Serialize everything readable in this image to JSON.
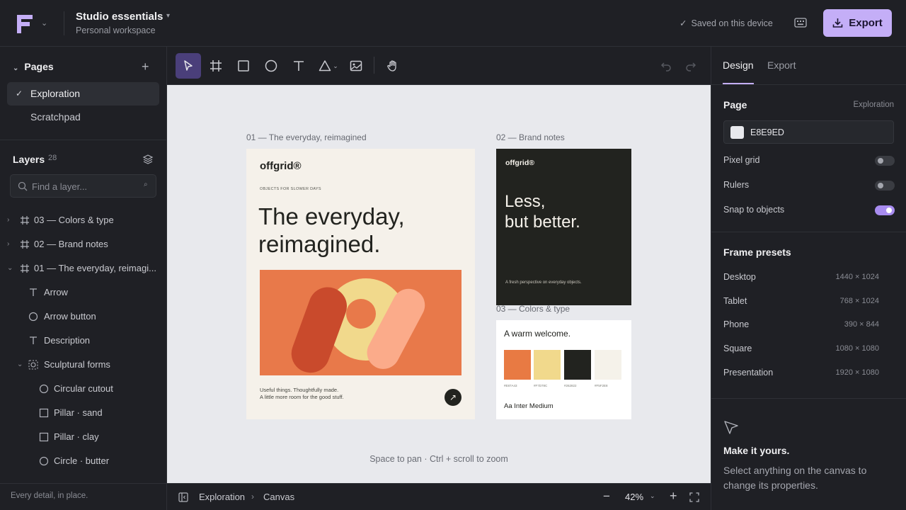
{
  "header": {
    "workspace_title": "Studio essentials",
    "workspace_subtitle": "Personal workspace",
    "saved_status": "Saved on this device",
    "export_label": "Export",
    "accent": "#c4aef7"
  },
  "pages": {
    "heading": "Pages",
    "items": [
      {
        "label": "Exploration",
        "active": true
      },
      {
        "label": "Scratchpad",
        "active": false
      }
    ]
  },
  "layers": {
    "heading": "Layers",
    "count": "28",
    "search_placeholder": "Find a layer...",
    "search_shortcut": "⌕",
    "items": [
      {
        "label": "03 — Colors & type",
        "icon": "frame-icon",
        "level": 0,
        "expanded": false
      },
      {
        "label": "02 — Brand notes",
        "icon": "frame-icon",
        "level": 0,
        "expanded": false
      },
      {
        "label": "01 — The everyday, reimagi...",
        "icon": "frame-icon",
        "level": 0,
        "expanded": true
      },
      {
        "label": "Arrow",
        "icon": "text-icon",
        "level": 1
      },
      {
        "label": "Arrow button",
        "icon": "ellipse-icon",
        "level": 1
      },
      {
        "label": "Description",
        "icon": "text-icon",
        "level": 1
      },
      {
        "label": "Sculptural forms",
        "icon": "group-icon",
        "level": 1,
        "expanded": true
      },
      {
        "label": "Circular cutout",
        "icon": "ellipse-icon",
        "level": 2
      },
      {
        "label": "Pillar · sand",
        "icon": "rectangle-icon",
        "level": 2
      },
      {
        "label": "Pillar · clay",
        "icon": "rectangle-icon",
        "level": 2
      },
      {
        "label": "Circle · butter",
        "icon": "ellipse-icon",
        "level": 2
      }
    ],
    "footer": "Every detail, in place."
  },
  "toolbar": {
    "tools": [
      "select-tool",
      "frame-tool",
      "rectangle-tool",
      "ellipse-tool",
      "text-tool",
      "shape-tool",
      "image-tool",
      "hand-tool"
    ],
    "active_tool": "select-tool"
  },
  "canvas": {
    "background": "#E8E9ED",
    "hint": "Space to pan · Ctrl + scroll to zoom",
    "frame1": {
      "label": "01 — The everyday, reimagined",
      "logo": "offgrid®",
      "kicker": "OBJECTS FOR SLOWER DAYS",
      "headline_1": "The everyday,",
      "headline_2": "reimagined.",
      "desc_1": "Useful things. Thoughtfully made.",
      "desc_2": "A little more room for the good stuff.",
      "arrow": "↗"
    },
    "frame2": {
      "label": "02 — Brand notes",
      "logo": "offgrid®",
      "headline_1": "Less,",
      "headline_2": "but better.",
      "sub": "A fresh perspective on everyday objects."
    },
    "frame3": {
      "label": "03 — Colors & type",
      "headline": "A warm welcome.",
      "swatches": [
        {
          "hex": "#E87A43",
          "color": "#e87a43"
        },
        {
          "hex": "#F7D78C",
          "color": "#f1d98c"
        },
        {
          "hex": "#262822",
          "color": "#22231f"
        },
        {
          "hex": "#F5F2E8",
          "color": "#f5f2ea"
        }
      ],
      "type_sample": "Aa  Inter Medium"
    }
  },
  "bottombar": {
    "crumb_1": "Exploration",
    "crumb_sep": "›",
    "crumb_2": "Canvas",
    "zoom": "42%"
  },
  "right_panel": {
    "tabs": [
      {
        "label": "Design",
        "active": true
      },
      {
        "label": "Export",
        "active": false
      }
    ],
    "page_heading": "Page",
    "page_name": "Exploration",
    "page_color": "E8E9ED",
    "toggles": [
      {
        "label": "Pixel grid",
        "on": false
      },
      {
        "label": "Rulers",
        "on": false
      },
      {
        "label": "Snap to objects",
        "on": true
      }
    ],
    "presets_heading": "Frame presets",
    "presets": [
      {
        "name": "Desktop",
        "size": "1440 × 1024"
      },
      {
        "name": "Tablet",
        "size": "768 × 1024"
      },
      {
        "name": "Phone",
        "size": "390 × 844"
      },
      {
        "name": "Square",
        "size": "1080 × 1080"
      },
      {
        "name": "Presentation",
        "size": "1920 × 1080"
      }
    ],
    "empty_title": "Make it yours.",
    "empty_desc": "Select anything on the canvas to change its properties."
  }
}
